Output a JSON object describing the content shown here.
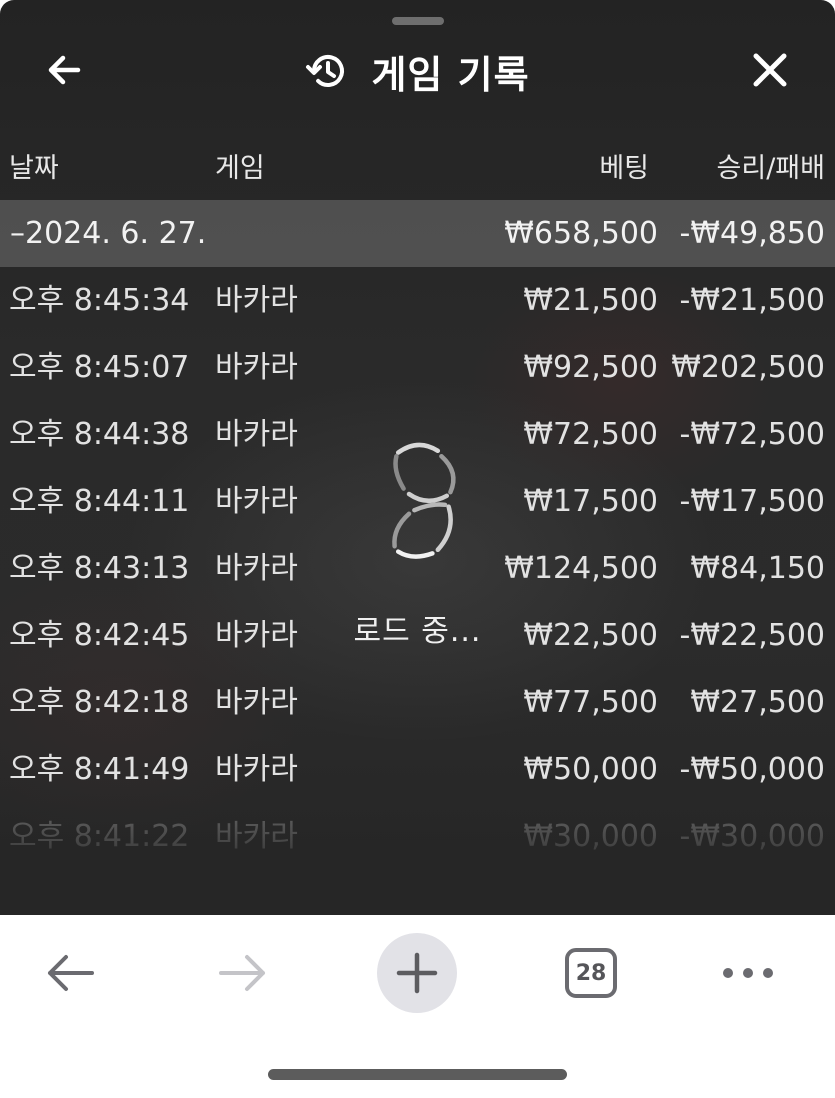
{
  "header": {
    "title": "게임 기록",
    "back_icon": "arrow-left-icon",
    "history_icon": "history-icon",
    "close_icon": "close-icon"
  },
  "columns": {
    "date": "날짜",
    "game": "게임",
    "bet": "베팅",
    "win_loss": "승리/패배"
  },
  "date_group": {
    "date": "–2024. 6. 27.",
    "total_bet": "₩658,500",
    "total_win_loss": "-₩49,850"
  },
  "rows": [
    {
      "time": "오후 8:45:34",
      "game": "바카라",
      "bet": "₩21,500",
      "win_loss": "-₩21,500"
    },
    {
      "time": "오후 8:45:07",
      "game": "바카라",
      "bet": "₩92,500",
      "win_loss": "₩202,500"
    },
    {
      "time": "오후 8:44:38",
      "game": "바카라",
      "bet": "₩72,500",
      "win_loss": "-₩72,500"
    },
    {
      "time": "오후 8:44:11",
      "game": "바카라",
      "bet": "₩17,500",
      "win_loss": "-₩17,500"
    },
    {
      "time": "오후 8:43:13",
      "game": "바카라",
      "bet": "₩124,500",
      "win_loss": "₩84,150"
    },
    {
      "time": "오후 8:42:45",
      "game": "바카라",
      "bet": "₩22,500",
      "win_loss": "-₩22,500"
    },
    {
      "time": "오후 8:42:18",
      "game": "바카라",
      "bet": "₩77,500",
      "win_loss": "₩27,500"
    },
    {
      "time": "오후 8:41:49",
      "game": "바카라",
      "bet": "₩50,000",
      "win_loss": "-₩50,000"
    },
    {
      "time": "오후 8:41:22",
      "game": "바카라",
      "bet": "₩30,000",
      "win_loss": "-₩30,000"
    }
  ],
  "loader": {
    "text": "로드 중...",
    "icon": "loading-spinner-icon"
  },
  "browser_toolbar": {
    "back_icon": "arrow-left-icon",
    "forward_icon": "arrow-right-icon",
    "new_tab_icon": "plus-icon",
    "tab_count": "28",
    "more_icon": "more-horizontal-icon"
  }
}
